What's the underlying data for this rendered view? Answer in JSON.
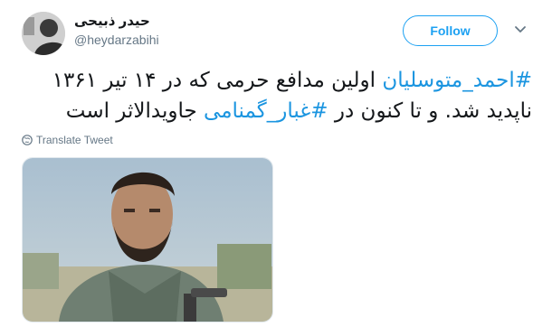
{
  "author": {
    "display_name": "حیدر ذبیحی",
    "handle": "@heydarzabihi"
  },
  "follow_button": {
    "label": "Follow"
  },
  "tweet": {
    "line1_hashtag": "#احمد_متوسلیان",
    "line1_text": " اولین مدافع حرمی که در ۱۴ تیر ۱۳۶۱",
    "line2_text_a": "ناپدید شد. و تا کنون در ",
    "line2_hashtag": "#غبار_گمنامی",
    "line2_text_b": " جاویدالاثر است"
  },
  "translate": {
    "label": "Translate Tweet"
  },
  "icons": {
    "globe": "globe-icon",
    "chevron": "chevron-down-icon"
  },
  "colors": {
    "accent": "#1da1f2",
    "hashtag": "#1b95e0",
    "secondary_text": "#657786"
  }
}
